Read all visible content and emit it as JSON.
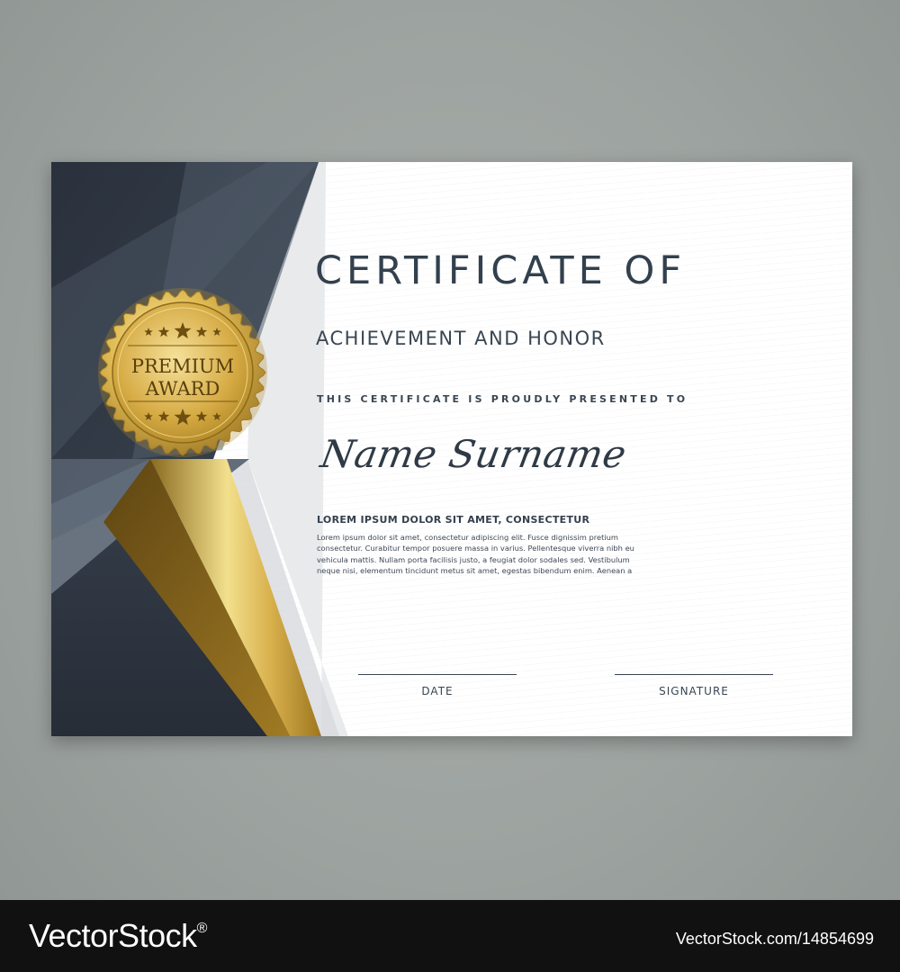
{
  "certificate": {
    "title": "CERTIFICATE OF",
    "subtitle": "ACHIEVEMENT AND HONOR",
    "presented_text": "THIS CERTIFICATE IS PROUDLY PRESENTED TO",
    "recipient_name": "Name Surname",
    "body_heading": "LOREM IPSUM DOLOR SIT AMET, CONSECTETUR",
    "body_lines": [
      "Lorem ipsum dolor sit amet, consectetur adipiscing elit. Fusce dignissim pretium",
      "consectetur. Curabitur tempor posuere massa in varius. Pellentesque viverra nibh eu",
      "vehicula mattis. Nullam porta facilisis justo, a feugiat dolor sodales sed. Vestibulum",
      "neque nisi, elementum tincidunt metus sit amet, egestas bibendum enim. Aenean a"
    ],
    "date_label": "DATE",
    "signature_label": "SIGNATURE"
  },
  "badge": {
    "line1": "PREMIUM",
    "line2": "AWARD",
    "icon": "star-icon"
  },
  "footer": {
    "brand": "VectorStock",
    "registered_mark": "®",
    "image_id": "VectorStock.com/14854699"
  },
  "colors": {
    "background": "#9da3a0",
    "dark_panel": "#2c3540",
    "gold": "#c9a03a",
    "text": "#33404d"
  }
}
